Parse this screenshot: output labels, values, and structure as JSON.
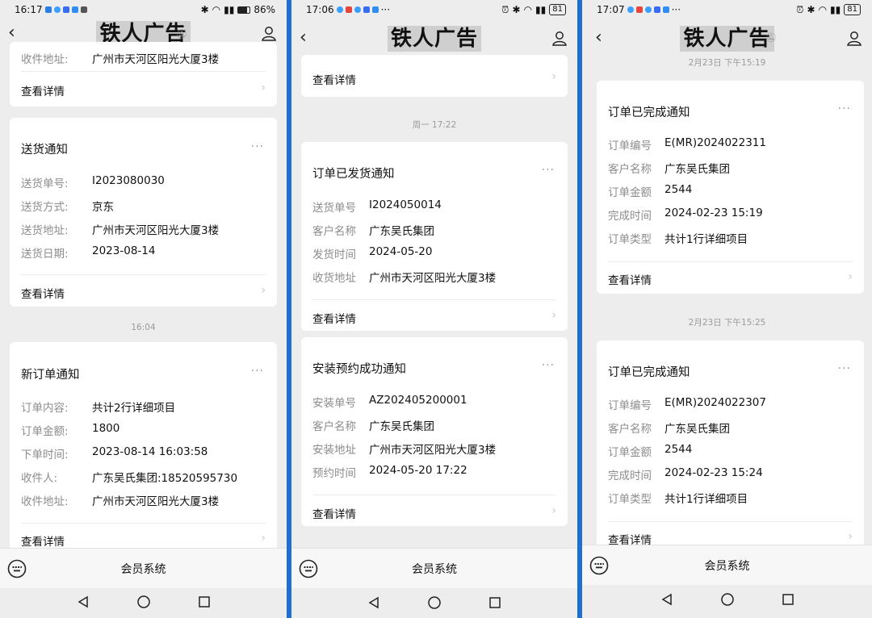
{
  "app_title": "铁人广告",
  "bottom_label": "会员系统",
  "detail_label": "查看详情",
  "more_label": "···",
  "screens": [
    {
      "status": {
        "time": "16:17",
        "battery": "86%"
      },
      "top_partial": {
        "key": "收件地址:",
        "value": "广州市天河区阳光大厦3楼"
      },
      "delivery": {
        "title": "送货通知",
        "rows": [
          {
            "key": "送货单号:",
            "value": "I2023080030"
          },
          {
            "key": "送货方式:",
            "value": "京东"
          },
          {
            "key": "送货地址:",
            "value": "广州市天河区阳光大厦3楼"
          },
          {
            "key": "送货日期:",
            "value": "2023-08-14"
          }
        ]
      },
      "timestamp": "16:04",
      "new_order": {
        "title": "新订单通知",
        "rows": [
          {
            "key": "订单内容:",
            "value": "共计2行详细项目"
          },
          {
            "key": "订单金额:",
            "value": "1800"
          },
          {
            "key": "下单时间:",
            "value": "2023-08-14 16:03:58"
          },
          {
            "key": "收件人:",
            "value": "广东吴氏集团:18520595730"
          },
          {
            "key": "收件地址:",
            "value": "广州市天河区阳光大厦3楼"
          }
        ]
      }
    },
    {
      "status": {
        "time": "17:06",
        "battery": "81"
      },
      "timestamp": "周一 17:22",
      "shipped": {
        "title": "订单已发货通知",
        "rows": [
          {
            "key": "送货单号",
            "value": "I2024050014"
          },
          {
            "key": "客户名称",
            "value": "广东吴氏集团"
          },
          {
            "key": "发货时间",
            "value": "2024-05-20"
          },
          {
            "key": "收货地址",
            "value": "广州市天河区阳光大厦3楼"
          }
        ]
      },
      "install": {
        "title": "安装预约成功通知",
        "rows": [
          {
            "key": "安装单号",
            "value": "AZ202405200001"
          },
          {
            "key": "客户名称",
            "value": "广东吴氏集团"
          },
          {
            "key": "安装地址",
            "value": "广州市天河区阳光大厦3楼"
          },
          {
            "key": "预约时间",
            "value": "2024-05-20 17:22"
          }
        ]
      }
    },
    {
      "status": {
        "time": "17:07",
        "battery": "81"
      },
      "timestamp_top": "2月23日 下午15:19",
      "complete1": {
        "title": "订单已完成通知",
        "rows": [
          {
            "key": "订单编号",
            "value": "E(MR)2024022311"
          },
          {
            "key": "客户名称",
            "value": "广东吴氏集团"
          },
          {
            "key": "订单金额",
            "value": "2544"
          },
          {
            "key": "完成时间",
            "value": "2024-02-23 15:19"
          },
          {
            "key": "订单类型",
            "value": "共计1行详细项目"
          }
        ]
      },
      "timestamp_mid": "2月23日 下午15:25",
      "complete2": {
        "title": "订单已完成通知",
        "rows": [
          {
            "key": "订单编号",
            "value": "E(MR)2024022307"
          },
          {
            "key": "客户名称",
            "value": "广东吴氏集团"
          },
          {
            "key": "订单金额",
            "value": "2544"
          },
          {
            "key": "完成时间",
            "value": "2024-02-23 15:24"
          },
          {
            "key": "订单类型",
            "value": "共计1行详细项目"
          }
        ]
      }
    }
  ]
}
